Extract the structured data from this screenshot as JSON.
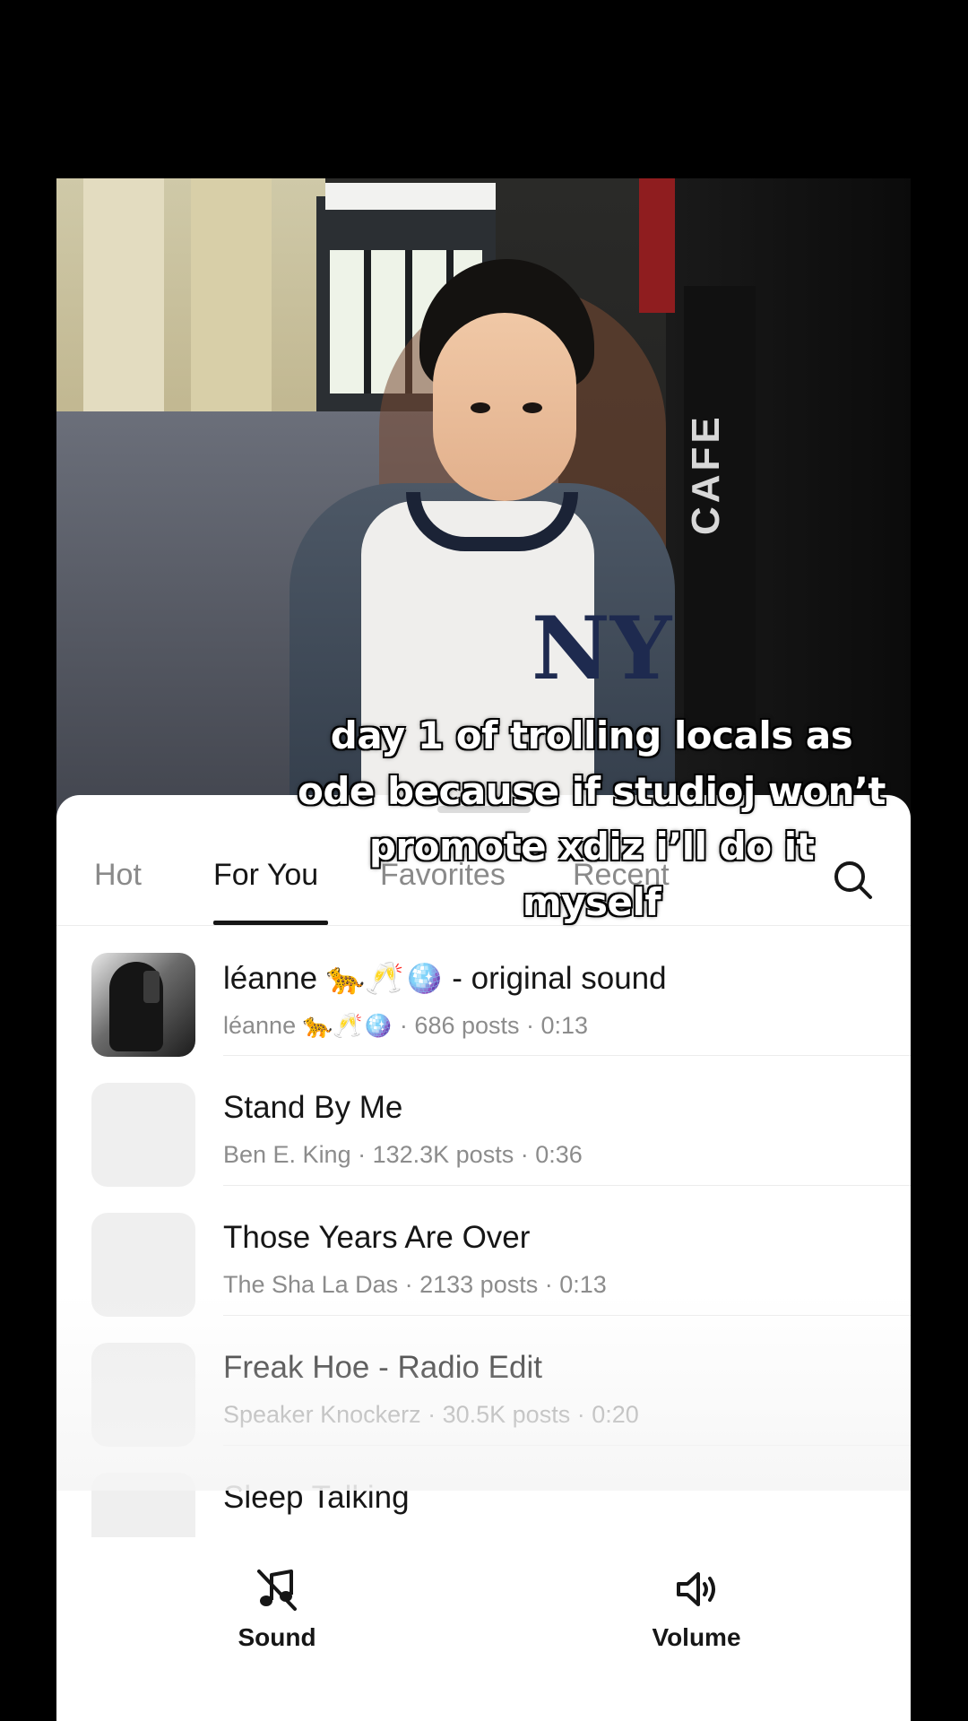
{
  "video": {
    "caption": "day 1 of trolling locals as ode because if studioj won’t promote xdiz i’ll do it myself",
    "scene_sign": "CAFE",
    "shirt_logo": "NY"
  },
  "sheet": {
    "tabs": [
      {
        "label": "Hot",
        "active": false
      },
      {
        "label": "For You",
        "active": true
      },
      {
        "label": "Favorites",
        "active": false
      },
      {
        "label": "Recent",
        "active": false
      }
    ],
    "search_icon": "search-icon",
    "sounds": [
      {
        "title": "léanne 🐆🥂🪩 - original sound",
        "subtitle": "léanne 🐆🥂🪩 · 686 posts · 0:13",
        "has_photo": true
      },
      {
        "title": "Stand By Me",
        "subtitle": "Ben E. King · 132.3K posts · 0:36",
        "has_photo": false
      },
      {
        "title": "Those Years Are Over",
        "subtitle": "The Sha La Das · 2133 posts · 0:13",
        "has_photo": false
      },
      {
        "title": "Freak Hoe - Radio Edit",
        "subtitle": "Speaker Knockerz · 30.5K posts · 0:20",
        "has_photo": false
      },
      {
        "title": "Sleep Talking",
        "subtitle": "",
        "has_photo": false
      }
    ],
    "bottom": {
      "sound_label": "Sound",
      "sound_icon": "music-off-icon",
      "volume_label": "Volume",
      "volume_icon": "speaker-icon"
    }
  }
}
